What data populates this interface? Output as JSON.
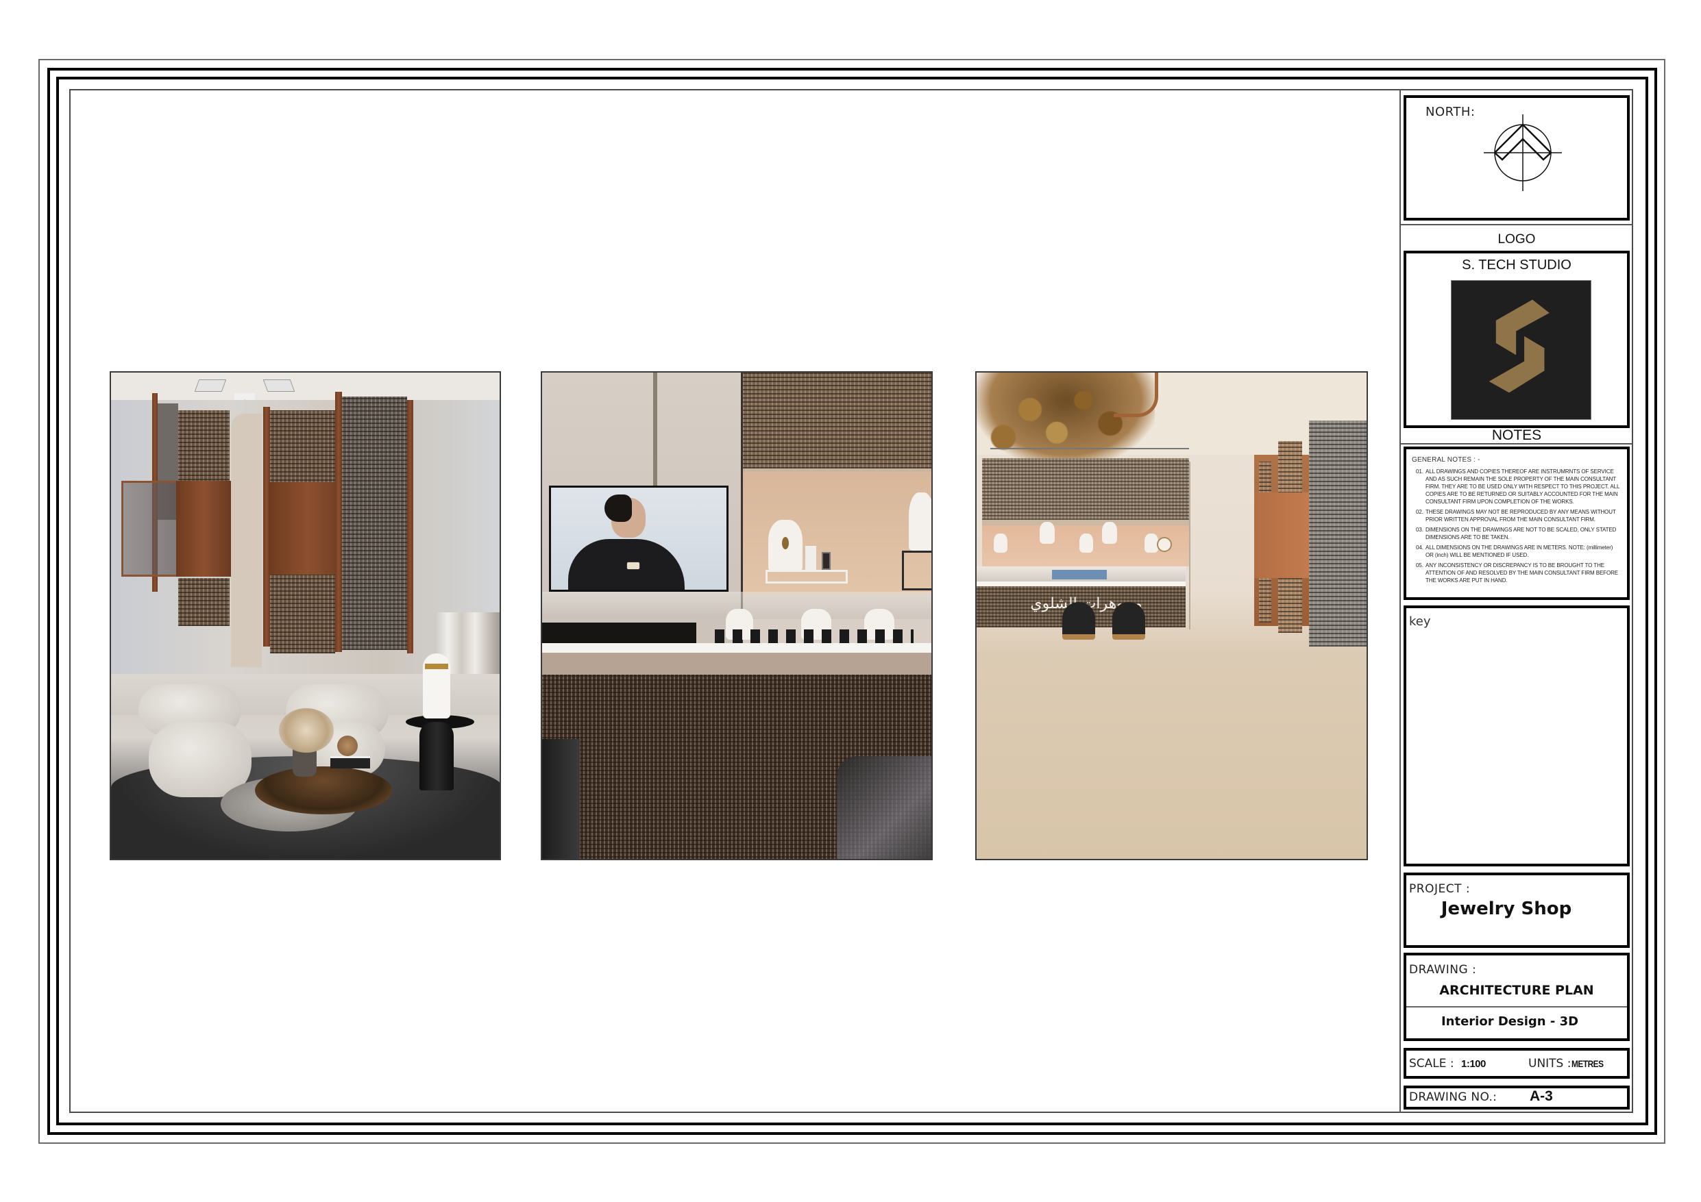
{
  "sheet": {
    "renders": [
      {
        "id": "render-lounge",
        "subject": "Lounge seating area with copper mesh screens, boucle armchairs, round coffee table, bust sculpture on black marble side table"
      },
      {
        "id": "render-display-wall",
        "subject": "Display counter with digital screen showing model, necklace busts, ring stands, perforated bronze panels"
      },
      {
        "id": "render-shop-front",
        "subject": "Shop front with leaf chandelier, backlit jewelry showcase, counter with Arabic signage, two black stools, copper screens",
        "signage_text": "مجوهرات الشلوي"
      }
    ]
  },
  "title_block": {
    "north": {
      "label": "NORTH:",
      "icon": "north-arrow-icon"
    },
    "logo": {
      "label": "LOGO",
      "studio_name": "S. TECH STUDIO",
      "mark_colors": {
        "background": "#1f1f1f",
        "mark": "#8f7449"
      }
    },
    "notes": {
      "label": "NOTES",
      "title": "GENERAL NOTES : -",
      "items": [
        {
          "num": "01.",
          "text": "ALL DRAWINGS AND COPIES THEREOF ARE INSTRUMRNTS OF SERVICE AND AS SUCH REMAIN THE SOLE PROPERTY OF THE MAIN CONSULTANT FIRM. THEY ARE TO BE USED ONLY WITH RESPECT TO THIS PROJECT. ALL COPIES ARE TO BE RETURNED OR SUITABLY ACCOUNTED FOR THE MAIN CONSULTANT FIRM UPON COMPLETION OF THE WORKS."
        },
        {
          "num": "02.",
          "text": "THESE DRAWINGS MAY NOT BE REPRODUCED BY ANY MEANS WITHOUT PRIOR WRITTEN APPROVAL FROM THE MAIN CONSULTANT FIRM."
        },
        {
          "num": "03.",
          "text": "DIMENSIONS ON THE DRAWINGS ARE NOT TO BE SCALED, ONLY STATED DIMENSIONS ARE TO BE TAKEN."
        },
        {
          "num": "04.",
          "text": "ALL DIMENSIONS ON THE DRAWINGS ARE IN METERS. NOTE: (millimeter) OR (inch) WILL BE MENTIONED IF USED."
        },
        {
          "num": "05.",
          "text": "ANY INCONSISTENCY OR DISCREPANCY IS TO BE BROUGHT TO THE ATTENTION OF AND RESOLVED BY THE MAIN CONSULTANT FIRM BEFORE THE WORKS ARE PUT IN HAND."
        }
      ]
    },
    "key": {
      "label": "key"
    },
    "project": {
      "label": "PROJECT :",
      "name": "Jewelry Shop"
    },
    "drawing": {
      "label": "DRAWING :",
      "title": "ARCHITECTURE PLAN",
      "subtitle": "Interior Design - 3D"
    },
    "scale": {
      "label": "SCALE :",
      "value": "1:100"
    },
    "units": {
      "label": "UNITS :",
      "value": "METRES"
    },
    "drawing_no": {
      "label": "DRAWING NO.:",
      "value": "A-3"
    }
  }
}
